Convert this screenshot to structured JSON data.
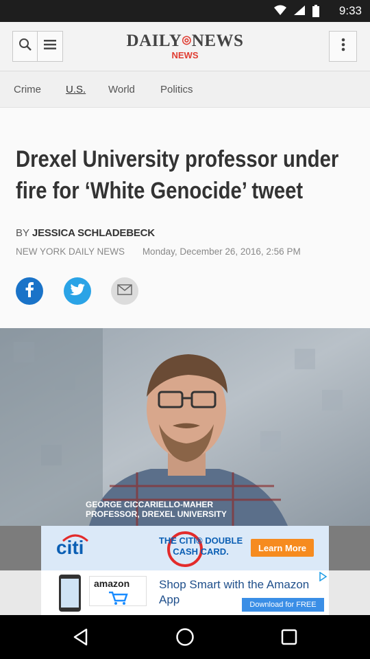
{
  "status_bar": {
    "time": "9:33"
  },
  "header": {
    "logo_main_left": "DAILY",
    "logo_main_right": "NEWS",
    "logo_sub": "NEWS"
  },
  "nav": {
    "items": [
      {
        "label": "Crime"
      },
      {
        "label": "U.S."
      },
      {
        "label": "World"
      },
      {
        "label": "Politics"
      }
    ],
    "active_index": 1
  },
  "article": {
    "headline": "Drexel University professor under fire for ‘White Genocide’ tweet",
    "by_prefix": "BY",
    "author": "JESSICA SCHLADEBECK",
    "publisher": "NEW YORK DAILY NEWS",
    "date": "Monday, December 26, 2016, 2:56 PM"
  },
  "photo": {
    "caption_line1": "GEORGE CICCARIELLO-MAHER",
    "caption_line2": "PROFESSOR, DREXEL UNIVERSITY"
  },
  "ads": {
    "citi": {
      "brand": "citi",
      "headline": "THE CITI® DOUBLE CASH CARD.",
      "cta": "Learn More"
    },
    "amazon": {
      "brand": "amazon",
      "headline": "Shop Smart with the Amazon App",
      "cta": "Download for FREE"
    }
  },
  "colors": {
    "accent_red": "#e03c31",
    "facebook": "#1a73c8",
    "twitter": "#2aa3e6",
    "mail": "#dcdcdc"
  }
}
